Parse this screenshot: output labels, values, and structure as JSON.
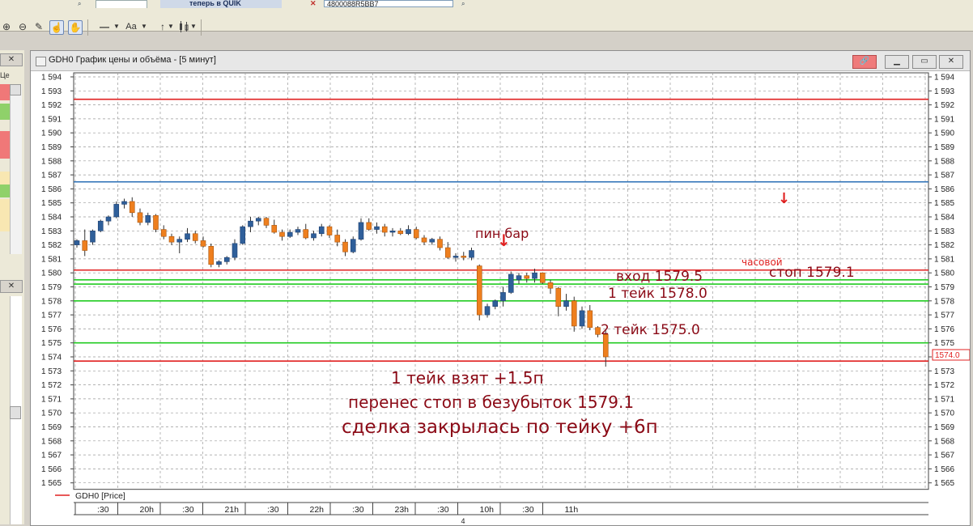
{
  "toolbar": {
    "quik_banner": "теперь в QUIK",
    "account_value": "4800088R5BB7",
    "line_style_label": "—",
    "font_button_label": "Aa"
  },
  "left_panel": {
    "column_header": "Це"
  },
  "chart_window": {
    "title": "GDH0 График цены и объёма - [5 минут]",
    "legend_label": "GDH0 [Price]",
    "price_marker": "1574.0",
    "window_buttons": [
      "link",
      "minimize",
      "maximize",
      "close"
    ]
  },
  "annotations": {
    "pin_bar": "пин бар",
    "hourly": "часовой",
    "stop": "стоп 1579.1",
    "entry": "вход 1579.5",
    "take1": "1 тейк 1578.0",
    "take2": "2 тейк 1575.0",
    "note1": "1 тейк взят +1.5п",
    "note2": "перенес стоп в безубыток 1579.1",
    "note3": "сделка закрылась по тейку +6п"
  },
  "chart_data": {
    "type": "candlestick",
    "title": "",
    "y_axis": {
      "min": 1565,
      "max": 1594,
      "step": 1,
      "tick_labels": [
        "1 594",
        "1 593",
        "1 592",
        "1 591",
        "1 590",
        "1 589",
        "1 588",
        "1 587",
        "1 586",
        "1 585",
        "1 584",
        "1 583",
        "1 582",
        "1 581",
        "1 580",
        "1 579",
        "1 578",
        "1 577",
        "1 576",
        "1 575",
        "1 574",
        "1 573",
        "1 572",
        "1 571",
        "1 570",
        "1 569",
        "1 568",
        "1 567",
        "1 566",
        "1 565"
      ]
    },
    "x_axis": {
      "tick_labels": [
        ":30",
        "20h",
        ":30",
        "21h",
        ":30",
        "22h",
        ":30",
        "23h",
        ":30",
        "10h",
        ":30",
        "11h"
      ],
      "sub_label": "4"
    },
    "grid": true,
    "horizontal_levels": [
      {
        "price": 1592.4,
        "color": "#e02020",
        "role": "resistance"
      },
      {
        "price": 1586.5,
        "color": "#2a6fb5",
        "role": "level"
      },
      {
        "price": 1580.2,
        "color": "#e02020",
        "role": "stop"
      },
      {
        "price": 1579.5,
        "color": "#22cc22",
        "role": "entry"
      },
      {
        "price": 1579.2,
        "color": "#22cc22",
        "role": "breakeven"
      },
      {
        "price": 1578.0,
        "color": "#22cc22",
        "role": "take1"
      },
      {
        "price": 1575.0,
        "color": "#22cc22",
        "role": "take2"
      },
      {
        "price": 1573.7,
        "color": "#e02020",
        "role": "support"
      }
    ],
    "candles": [
      [
        1582.0,
        1582.4,
        1581.8,
        1582.3
      ],
      [
        1582.3,
        1583.1,
        1581.2,
        1581.6
      ],
      [
        1582.2,
        1583.1,
        1582.0,
        1583.0
      ],
      [
        1583.0,
        1583.8,
        1582.9,
        1583.7
      ],
      [
        1583.7,
        1584.1,
        1583.4,
        1584.0
      ],
      [
        1584.0,
        1585.1,
        1583.9,
        1584.9
      ],
      [
        1584.9,
        1585.3,
        1584.6,
        1585.1
      ],
      [
        1585.1,
        1585.4,
        1584.0,
        1584.3
      ],
      [
        1584.3,
        1584.6,
        1583.4,
        1583.6
      ],
      [
        1583.6,
        1584.3,
        1583.4,
        1584.1
      ],
      [
        1584.1,
        1584.2,
        1582.9,
        1583.1
      ],
      [
        1583.1,
        1583.4,
        1582.4,
        1582.6
      ],
      [
        1582.6,
        1582.8,
        1582.0,
        1582.2
      ],
      [
        1582.2,
        1582.6,
        1581.4,
        1582.4
      ],
      [
        1582.4,
        1583.2,
        1582.2,
        1582.8
      ],
      [
        1582.8,
        1583.0,
        1582.1,
        1582.3
      ],
      [
        1582.3,
        1582.6,
        1581.8,
        1581.9
      ],
      [
        1581.9,
        1582.1,
        1580.4,
        1580.6
      ],
      [
        1580.6,
        1580.9,
        1580.4,
        1580.8
      ],
      [
        1580.8,
        1581.2,
        1580.6,
        1581.1
      ],
      [
        1581.1,
        1582.4,
        1580.9,
        1582.1
      ],
      [
        1582.1,
        1583.4,
        1582.0,
        1583.3
      ],
      [
        1583.3,
        1584.0,
        1582.9,
        1583.7
      ],
      [
        1583.7,
        1584.0,
        1583.4,
        1583.9
      ],
      [
        1583.9,
        1584.0,
        1583.2,
        1583.4
      ],
      [
        1583.4,
        1583.8,
        1582.8,
        1582.9
      ],
      [
        1582.9,
        1583.1,
        1582.3,
        1582.6
      ],
      [
        1582.6,
        1583.1,
        1582.5,
        1582.9
      ],
      [
        1582.9,
        1583.3,
        1582.7,
        1583.1
      ],
      [
        1583.1,
        1583.5,
        1582.4,
        1582.5
      ],
      [
        1582.5,
        1583.0,
        1582.3,
        1582.8
      ],
      [
        1582.8,
        1583.5,
        1582.6,
        1583.3
      ],
      [
        1583.3,
        1583.4,
        1582.5,
        1582.7
      ],
      [
        1582.7,
        1583.1,
        1581.9,
        1582.2
      ],
      [
        1582.2,
        1582.4,
        1581.2,
        1581.5
      ],
      [
        1581.5,
        1582.6,
        1581.4,
        1582.4
      ],
      [
        1582.4,
        1583.9,
        1582.3,
        1583.6
      ],
      [
        1583.6,
        1583.9,
        1583.0,
        1583.1
      ],
      [
        1583.1,
        1583.6,
        1582.8,
        1583.3
      ],
      [
        1583.3,
        1583.5,
        1582.6,
        1582.9
      ],
      [
        1582.9,
        1583.2,
        1582.6,
        1583.0
      ],
      [
        1583.0,
        1583.2,
        1582.7,
        1582.8
      ],
      [
        1582.8,
        1583.4,
        1582.7,
        1583.1
      ],
      [
        1583.1,
        1583.3,
        1582.4,
        1582.5
      ],
      [
        1582.5,
        1582.7,
        1582.0,
        1582.2
      ],
      [
        1582.2,
        1582.5,
        1582.0,
        1582.4
      ],
      [
        1582.4,
        1582.6,
        1581.6,
        1581.8
      ],
      [
        1581.8,
        1582.2,
        1581.0,
        1581.1
      ],
      [
        1581.1,
        1581.4,
        1580.8,
        1581.2
      ],
      [
        1581.2,
        1581.5,
        1580.9,
        1581.1
      ],
      [
        1581.1,
        1581.8,
        1580.9,
        1581.6
      ],
      [
        1580.5,
        1580.6,
        1576.6,
        1577.0
      ],
      [
        1577.0,
        1577.8,
        1576.8,
        1577.6
      ],
      [
        1577.6,
        1578.1,
        1577.4,
        1578.0
      ],
      [
        1578.0,
        1579.0,
        1577.6,
        1578.6
      ],
      [
        1578.6,
        1580.1,
        1578.5,
        1579.9
      ],
      [
        1579.5,
        1580.0,
        1579.2,
        1579.8
      ],
      [
        1579.8,
        1580.0,
        1579.3,
        1579.6
      ],
      [
        1579.6,
        1580.3,
        1579.3,
        1580.0
      ],
      [
        1580.0,
        1580.0,
        1579.2,
        1579.3
      ],
      [
        1579.3,
        1579.5,
        1578.5,
        1578.9
      ],
      [
        1578.9,
        1579.0,
        1576.9,
        1577.6
      ],
      [
        1577.6,
        1578.5,
        1577.3,
        1578.0
      ],
      [
        1578.0,
        1578.3,
        1575.8,
        1576.2
      ],
      [
        1576.2,
        1577.6,
        1576.0,
        1577.3
      ],
      [
        1577.3,
        1577.7,
        1575.9,
        1576.1
      ],
      [
        1576.1,
        1576.2,
        1575.4,
        1575.6
      ],
      [
        1575.6,
        1575.9,
        1573.3,
        1574.0
      ]
    ]
  }
}
